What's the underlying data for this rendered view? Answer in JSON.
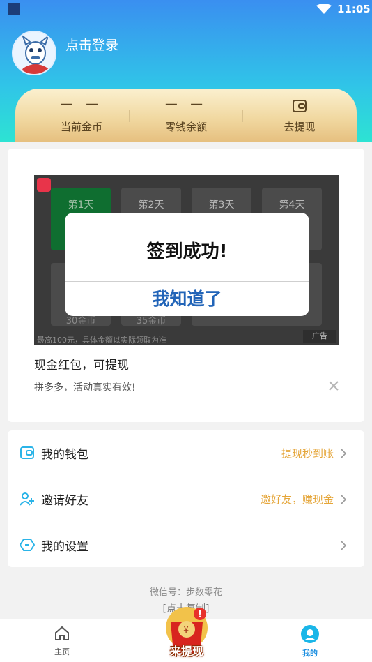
{
  "status": {
    "time": "11:05"
  },
  "user": {
    "login_label": "点击登录"
  },
  "stats": [
    {
      "value": "— —",
      "label": "当前金币"
    },
    {
      "value": "— —",
      "label": "零钱余额"
    },
    {
      "value": "",
      "label": "去提现"
    }
  ],
  "ad": {
    "days": [
      "第1天",
      "第2天",
      "第3天",
      "第4天"
    ],
    "coins": [
      "30金币",
      "35金币"
    ],
    "footnote": "最高100元，具体金额以实际领取为准",
    "tag": "广告",
    "title": "现金红包，可提现",
    "desc": "拼多多，活动真实有效!"
  },
  "dialog": {
    "title": "签到成功!",
    "button": "我知道了"
  },
  "menu": [
    {
      "label": "我的钱包",
      "hint": "提现秒到账"
    },
    {
      "label": "邀请好友",
      "hint": "邀好友，赚现金"
    },
    {
      "label": "我的设置",
      "hint": ""
    }
  ],
  "footer": {
    "wechat": "微信号：步数零花",
    "copy": "[点击复制]"
  },
  "tabs": {
    "home": "主页",
    "center": "来提现",
    "mine": "我的"
  },
  "colors": {
    "primary": "#2e7ee8",
    "accent": "#e5a63a",
    "gold": "#f1d9a2"
  }
}
